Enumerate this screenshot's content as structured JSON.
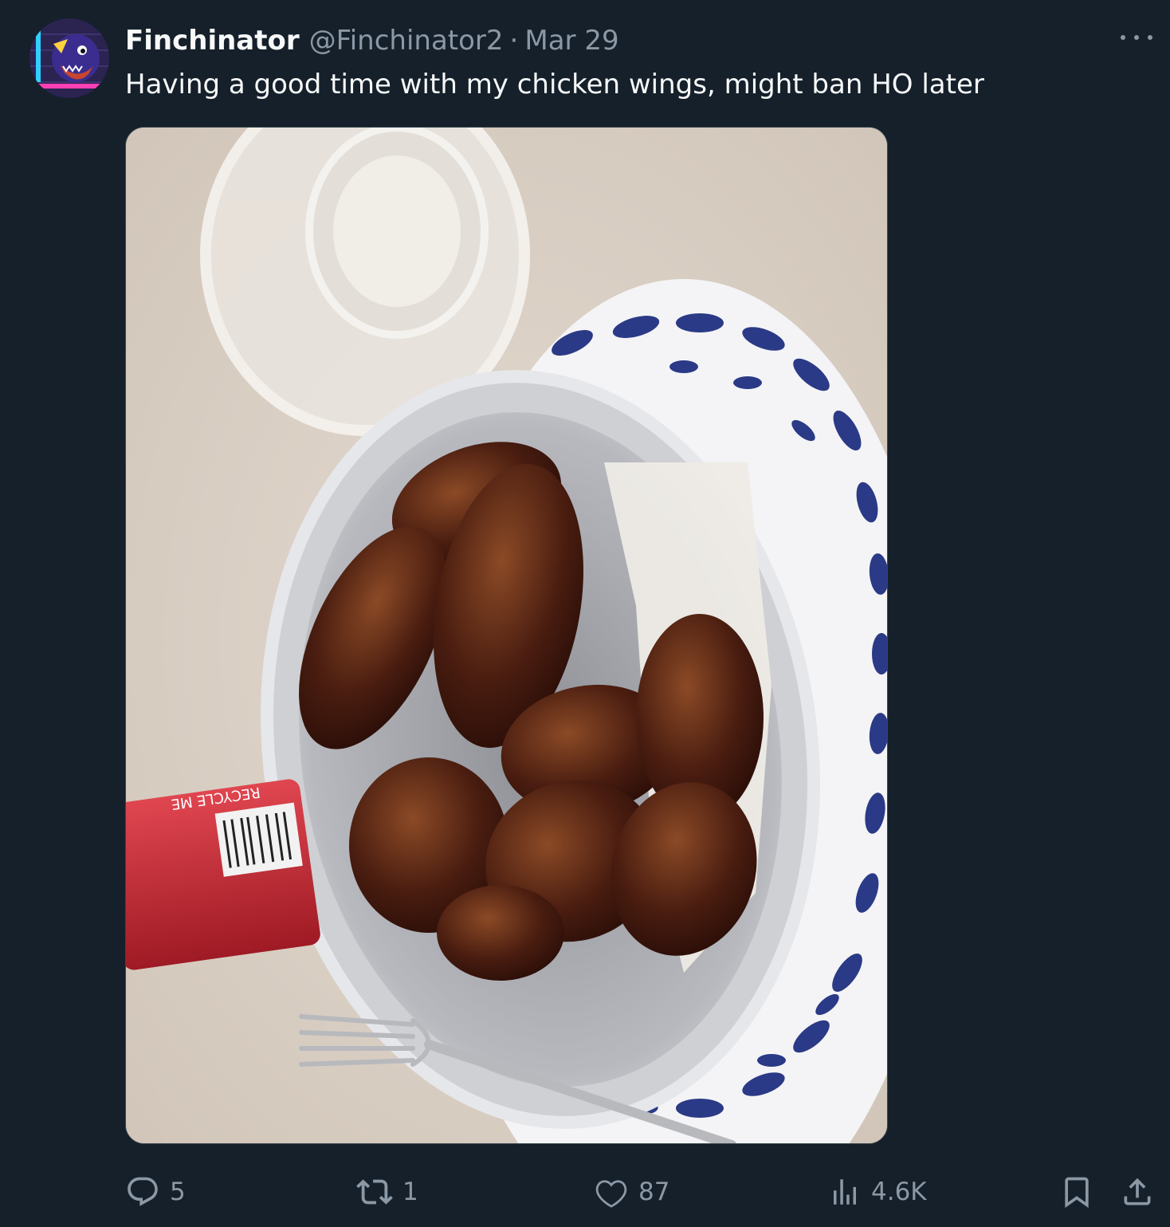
{
  "tweet": {
    "display_name": "Finchinator",
    "handle": "@Finchinator2",
    "separator": "·",
    "date": "Mar 29",
    "text": "Having a good time with my chicken wings, might ban HO later"
  },
  "media": {
    "can_label": "RECYCLE ME"
  },
  "actions": {
    "replies": "5",
    "reposts": "1",
    "likes": "87",
    "views": "4.6K"
  },
  "icons": {
    "more": "more-icon",
    "reply": "reply-icon",
    "repost": "repost-icon",
    "like": "heart-icon",
    "views": "views-icon",
    "bookmark": "bookmark-icon",
    "share": "share-icon"
  },
  "colors": {
    "background": "#15202b",
    "primary_text": "#f7f9f9",
    "secondary_text": "#8b98a5"
  }
}
